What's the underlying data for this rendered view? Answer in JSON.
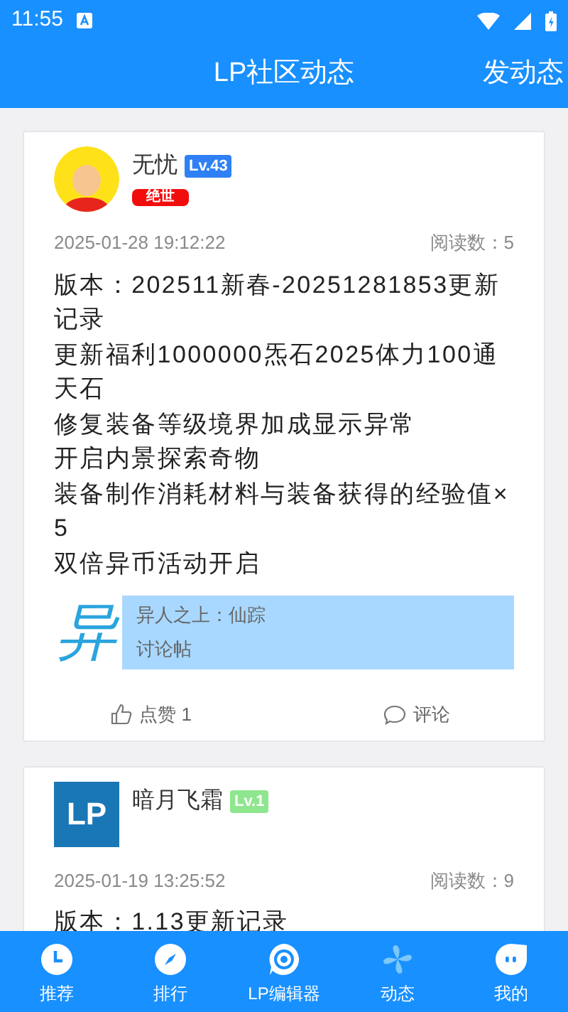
{
  "status_bar": {
    "time": "11:55"
  },
  "header": {
    "title": "LP社区动态",
    "action": "发动态"
  },
  "posts": [
    {
      "author": "无忧",
      "level": "Lv.43",
      "color": "#2f80f5",
      "title_badge": "绝世",
      "avatar": {
        "kind": "figure"
      },
      "date": "2025-01-28 19:12:22",
      "reads": "阅读数：5",
      "lines": [
        "版本：202511新春-20251281853更新记录",
        "更新福利1000000炁石2025体力100通天石",
        "修复装备等级境界加成显示异常",
        "开启内景探索奇物",
        "装备制作消耗材料与装备获得的经验值×5",
        "双倍异币活动开启"
      ],
      "link": {
        "logo": "异",
        "title": "异人之上：仙踪",
        "subtitle": "讨论帖"
      },
      "like": "点赞 1",
      "comment": "评论"
    },
    {
      "author": "暗月飞霜",
      "level": "Lv.1",
      "color": "#8ee68e",
      "avatar": {
        "kind": "logo",
        "text": "LP"
      },
      "date": "2025-01-19 13:25:52",
      "reads": "阅读数：9",
      "lines": [
        "版本：1.13更新记录"
      ]
    }
  ],
  "tabs": [
    {
      "label": "推荐",
      "selected": false
    },
    {
      "label": "排行",
      "selected": false
    },
    {
      "label": "LP编辑器",
      "selected": false
    },
    {
      "label": "动态",
      "selected": true
    },
    {
      "label": "我的",
      "selected": false
    }
  ]
}
